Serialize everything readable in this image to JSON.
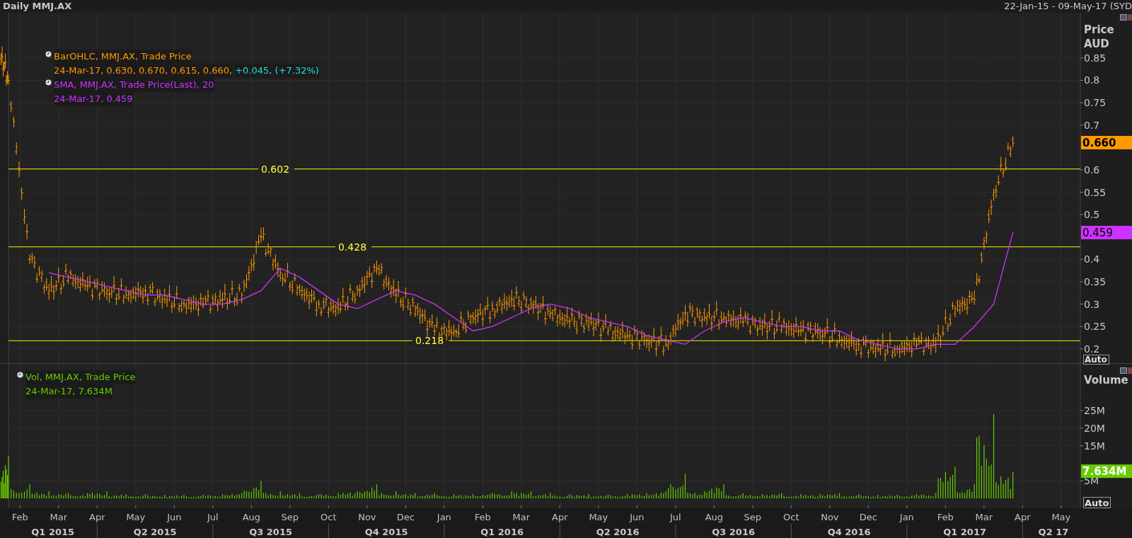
{
  "title_bar": {
    "title": "Daily MMJ.AX",
    "range": "22-Jan-15 - 09-May-17 (SYD"
  },
  "price_panel": {
    "axis_title": "Price",
    "axis_unit": "AUD",
    "scale_button": "Auto",
    "legend": [
      {
        "kind": "ohlc",
        "name": "BarOHLC, MMJ.AX, Trade Price",
        "values": "24-Mar-17, 0.630, 0.670, 0.615, 0.660,",
        "change": "+0.045, (+7.32%)",
        "color": "#ff9900"
      },
      {
        "kind": "sma",
        "name": "SMA, MMJ.AX, Trade Price(Last),  20",
        "values": "24-Mar-17, 0.459",
        "color": "#cc33ff"
      }
    ],
    "badges": [
      {
        "label": "0.660",
        "color": "#ff9900"
      },
      {
        "label": "0.459",
        "color": "#cc33ff"
      }
    ],
    "tick_labels": [
      "0.85",
      "0.8",
      "0.75",
      "0.7",
      "0.6",
      "0.55",
      "0.5",
      "0.4",
      "0.35",
      "0.3",
      "0.25",
      "0.2"
    ],
    "level_labels": [
      "0.602",
      "0.428",
      "0.218"
    ]
  },
  "volume_panel": {
    "axis_title": "Volume",
    "scale_button": "Auto",
    "legend": [
      {
        "kind": "volume",
        "name": "Vol, MMJ.AX, Trade Price",
        "values": "24-Mar-17, 7.634M",
        "color": "#66cc00"
      }
    ],
    "badges": [
      {
        "label": "7.634M",
        "color": "#66cc00"
      }
    ],
    "tick_labels": [
      "25M",
      "20M",
      "15M",
      "5M"
    ]
  },
  "time_axis": {
    "months": [
      "Feb",
      "Mar",
      "Apr",
      "May",
      "Jun",
      "Jul",
      "Aug",
      "Sep",
      "Oct",
      "Nov",
      "Dec",
      "Jan",
      "Feb",
      "Mar",
      "Apr",
      "May",
      "Jun",
      "Jul",
      "Aug",
      "Sep",
      "Oct",
      "Nov",
      "Dec",
      "Jan",
      "Feb",
      "Mar",
      "Apr",
      "May"
    ],
    "quarters": [
      "Q1 2015",
      "Q2 2015",
      "Q3 2015",
      "Q4 2015",
      "Q1 2016",
      "Q2 2016",
      "Q3 2016",
      "Q4 2016",
      "Q1 2017",
      "Q2 17"
    ]
  }
}
